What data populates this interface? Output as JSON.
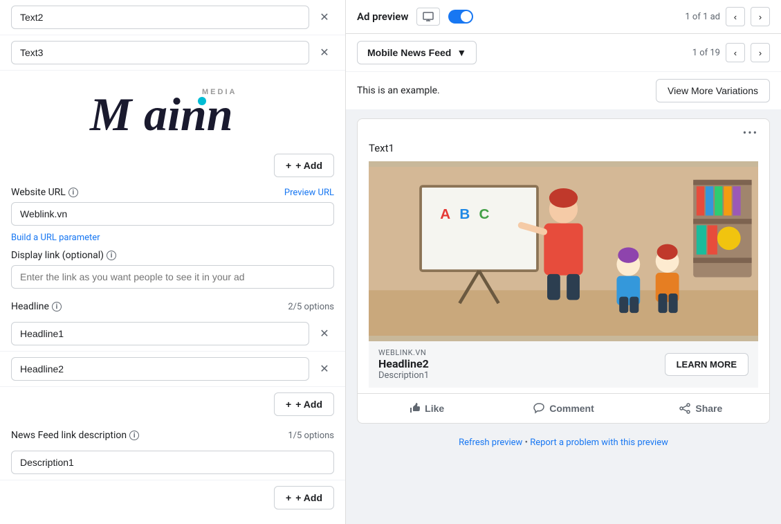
{
  "left_panel": {
    "fields": [
      {
        "id": "text2",
        "value": "Text2",
        "placeholder": "Text2"
      },
      {
        "id": "text3",
        "value": "Text3",
        "placeholder": "Text3"
      }
    ],
    "add_button": "+ Add",
    "website_url": {
      "label": "Website URL",
      "preview_url_label": "Preview URL",
      "value": "Weblink.vn"
    },
    "build_url_param": "Build a URL parameter",
    "display_link": {
      "label": "Display link (optional)",
      "placeholder": "Enter the link as you want people to see it in your ad"
    },
    "headline": {
      "label": "Headline",
      "options_label": "2/5 options",
      "fields": [
        {
          "value": "Headline1"
        },
        {
          "value": "Headline2"
        }
      ],
      "add_button": "+ Add"
    },
    "news_feed": {
      "label": "News Feed link description",
      "options_label": "1/5 options",
      "fields": [
        {
          "value": "Description1"
        }
      ],
      "add_button": "+ Add"
    }
  },
  "right_panel": {
    "header": {
      "ad_preview_label": "Ad preview",
      "page_counter": "1 of 1 ad"
    },
    "subheader": {
      "mobile_news_feed": "Mobile News Feed",
      "page_counter": "1 of 19"
    },
    "variation": {
      "example_text": "This is an example.",
      "view_more_button": "View More Variations"
    },
    "ad_card": {
      "dots": "•••",
      "ad_text": "Text1",
      "url_label": "WEBLINK.VN",
      "headline": "Headline2",
      "description": "Description1",
      "learn_more": "LEARN MORE"
    },
    "actions": {
      "like": "Like",
      "comment": "Comment",
      "share": "Share"
    },
    "footer": {
      "refresh": "Refresh preview",
      "separator": "•",
      "report": "Report a problem with this preview"
    }
  }
}
